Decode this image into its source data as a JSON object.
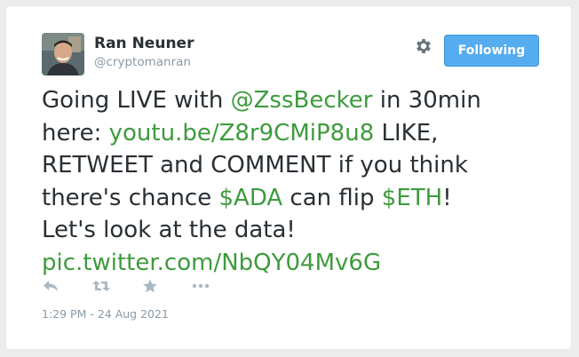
{
  "author": {
    "name": "Ran Neuner",
    "handle": "@cryptomanran"
  },
  "follow_button": {
    "label": "Following"
  },
  "tweet": {
    "line1": {
      "a": "Going LIVE with ",
      "mention": "@ZssBecker",
      "b": " in 30min"
    },
    "line2": {
      "a": "here: ",
      "url": "youtu.be/Z8r9CMiP8u8",
      "b": " LIKE,"
    },
    "line3": {
      "a": "RETWEET and COMMENT if you think"
    },
    "line4": {
      "a": "there's chance ",
      "cashtag1": "$ADA",
      "b": " can flip ",
      "cashtag2": "$ETH",
      "c": "!"
    },
    "line5": {
      "a": "Let's look at the data!"
    },
    "line6": {
      "pic": "pic.twitter.com/NbQY04Mv6G"
    }
  },
  "timestamp": "1:29 PM - 24 Aug 2021",
  "icons": {
    "settings": "gear-icon",
    "reply": "reply-icon",
    "retweet": "retweet-icon",
    "like": "star-icon",
    "more": "more-icon"
  },
  "colors": {
    "link": "#3d9b3d",
    "follow_button": "#55acee",
    "text": "#292f33",
    "muted": "#8899a6"
  }
}
